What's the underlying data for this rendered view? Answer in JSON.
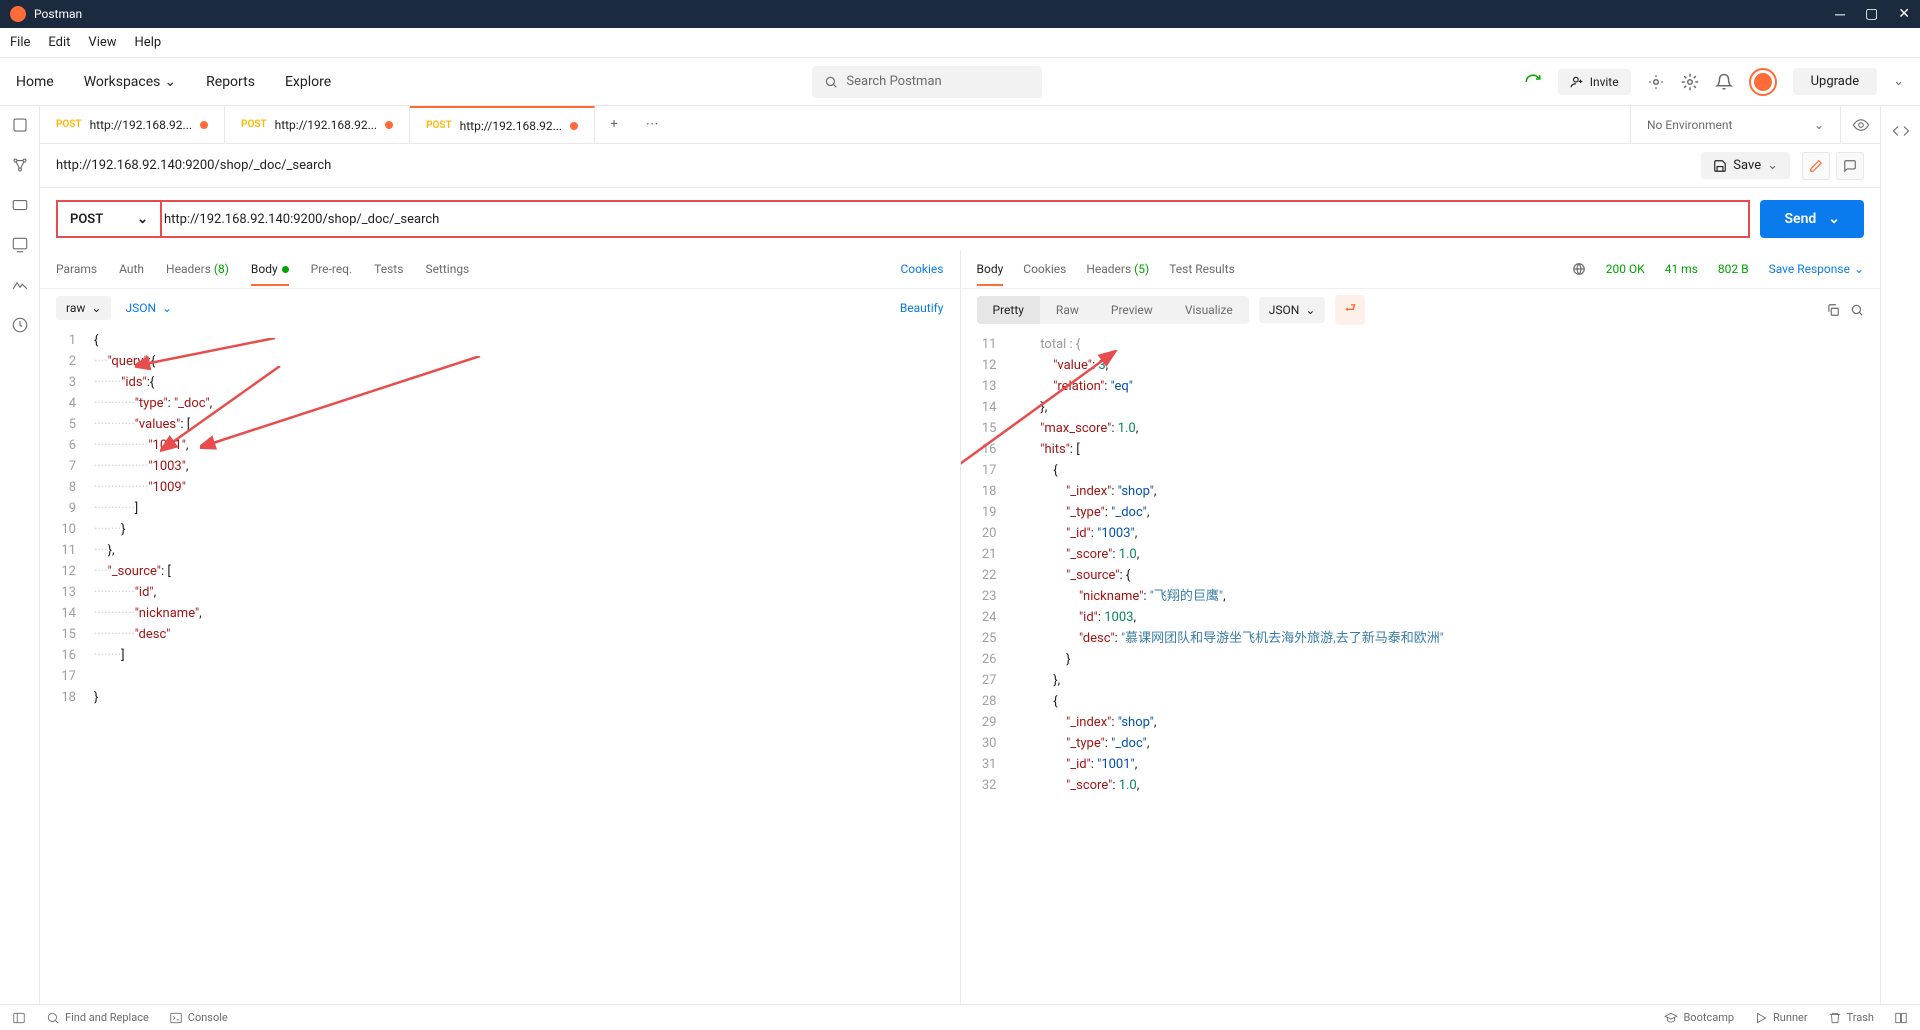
{
  "window": {
    "title": "Postman"
  },
  "menubar": [
    "File",
    "Edit",
    "View",
    "Help"
  ],
  "topnav": {
    "home": "Home",
    "workspaces": "Workspaces",
    "reports": "Reports",
    "explore": "Explore"
  },
  "search": {
    "placeholder": "Search Postman"
  },
  "invite": "Invite",
  "upgrade": "Upgrade",
  "tabs": [
    {
      "method": "POST",
      "label": "http://192.168.92...",
      "dirty": true
    },
    {
      "method": "POST",
      "label": "http://192.168.92...",
      "dirty": true
    },
    {
      "method": "POST",
      "label": "http://192.168.92...",
      "dirty": true
    }
  ],
  "env": {
    "label": "No Environment"
  },
  "request": {
    "title": "http://192.168.92.140:9200/shop/_doc/_search",
    "method": "POST",
    "url": "http://192.168.92.140:9200/shop/_doc/_search",
    "save": "Save",
    "send": "Send"
  },
  "reqTabs": {
    "params": "Params",
    "auth": "Auth",
    "headers": "Headers",
    "headersCount": "(8)",
    "body": "Body",
    "prereq": "Pre-req.",
    "tests": "Tests",
    "settings": "Settings",
    "cookies": "Cookies"
  },
  "bodyToolbar": {
    "raw": "raw",
    "json": "JSON",
    "beautify": "Beautify"
  },
  "reqBody": [
    {
      "n": 1,
      "t": [
        "{"
      ]
    },
    {
      "n": 2,
      "t": [
        "····",
        "\"query\"",
        ":",
        "{"
      ]
    },
    {
      "n": 3,
      "t": [
        "········",
        "\"ids\"",
        ":",
        "{"
      ]
    },
    {
      "n": 4,
      "t": [
        "············",
        "\"type\"",
        ": ",
        "\"_doc\"",
        ","
      ]
    },
    {
      "n": 5,
      "t": [
        "············",
        "\"values\"",
        ": ",
        "["
      ]
    },
    {
      "n": 6,
      "t": [
        "················",
        "\"1001\"",
        ","
      ]
    },
    {
      "n": 7,
      "t": [
        "················",
        "\"1003\"",
        ","
      ]
    },
    {
      "n": 8,
      "t": [
        "················",
        "\"1009\""
      ]
    },
    {
      "n": 9,
      "t": [
        "············",
        "]"
      ]
    },
    {
      "n": 10,
      "t": [
        "········",
        "}"
      ]
    },
    {
      "n": 11,
      "t": [
        "····",
        "}",
        ","
      ]
    },
    {
      "n": 12,
      "t": [
        "····",
        "\"_source\"",
        ": ",
        "["
      ]
    },
    {
      "n": 13,
      "t": [
        "············",
        "\"id\"",
        ","
      ]
    },
    {
      "n": 14,
      "t": [
        "············",
        "\"nickname\"",
        ","
      ]
    },
    {
      "n": 15,
      "t": [
        "············",
        "\"desc\""
      ]
    },
    {
      "n": 16,
      "t": [
        "········",
        "]"
      ]
    },
    {
      "n": 17,
      "t": [
        ""
      ]
    },
    {
      "n": 18,
      "t": [
        "}"
      ]
    }
  ],
  "respTabs": {
    "body": "Body",
    "cookies": "Cookies",
    "headers": "Headers",
    "headersCount": "(5)",
    "testResults": "Test Results"
  },
  "respMeta": {
    "status": "200 OK",
    "time": "41 ms",
    "size": "802 B",
    "save": "Save Response"
  },
  "respToolbar": {
    "pretty": "Pretty",
    "raw": "Raw",
    "preview": "Preview",
    "visualize": "Visualize",
    "json": "JSON"
  },
  "respBody": [
    {
      "n": 11,
      "segs": [
        {
          "c": "jcomment",
          "t": "        total : {"
        }
      ]
    },
    {
      "n": 12,
      "segs": [
        {
          "c": "jp",
          "t": "            "
        },
        {
          "c": "jk",
          "t": "\"value\""
        },
        {
          "c": "jp",
          "t": ": "
        },
        {
          "c": "jn",
          "t": "3"
        },
        {
          "c": "jp",
          "t": ","
        }
      ]
    },
    {
      "n": 13,
      "segs": [
        {
          "c": "jp",
          "t": "            "
        },
        {
          "c": "jk",
          "t": "\"relation\""
        },
        {
          "c": "jp",
          "t": ": "
        },
        {
          "c": "js",
          "t": "\"eq\""
        }
      ]
    },
    {
      "n": 14,
      "segs": [
        {
          "c": "jp",
          "t": "        },"
        }
      ]
    },
    {
      "n": 15,
      "segs": [
        {
          "c": "jp",
          "t": "        "
        },
        {
          "c": "jk",
          "t": "\"max_score\""
        },
        {
          "c": "jp",
          "t": ": "
        },
        {
          "c": "jn",
          "t": "1.0"
        },
        {
          "c": "jp",
          "t": ","
        }
      ]
    },
    {
      "n": 16,
      "segs": [
        {
          "c": "jp",
          "t": "        "
        },
        {
          "c": "jk",
          "t": "\"hits\""
        },
        {
          "c": "jp",
          "t": ": ["
        }
      ]
    },
    {
      "n": 17,
      "segs": [
        {
          "c": "jp",
          "t": "            {"
        }
      ]
    },
    {
      "n": 18,
      "segs": [
        {
          "c": "jp",
          "t": "                "
        },
        {
          "c": "jk",
          "t": "\"_index\""
        },
        {
          "c": "jp",
          "t": ": "
        },
        {
          "c": "js",
          "t": "\"shop\""
        },
        {
          "c": "jp",
          "t": ","
        }
      ]
    },
    {
      "n": 19,
      "segs": [
        {
          "c": "jp",
          "t": "                "
        },
        {
          "c": "jk",
          "t": "\"_type\""
        },
        {
          "c": "jp",
          "t": ": "
        },
        {
          "c": "js",
          "t": "\"_doc\""
        },
        {
          "c": "jp",
          "t": ","
        }
      ]
    },
    {
      "n": 20,
      "segs": [
        {
          "c": "jp",
          "t": "                "
        },
        {
          "c": "jk",
          "t": "\"_id\""
        },
        {
          "c": "jp",
          "t": ": "
        },
        {
          "c": "js",
          "t": "\"1003\""
        },
        {
          "c": "jp",
          "t": ","
        }
      ]
    },
    {
      "n": 21,
      "segs": [
        {
          "c": "jp",
          "t": "                "
        },
        {
          "c": "jk",
          "t": "\"_score\""
        },
        {
          "c": "jp",
          "t": ": "
        },
        {
          "c": "jn",
          "t": "1.0"
        },
        {
          "c": "jp",
          "t": ","
        }
      ]
    },
    {
      "n": 22,
      "segs": [
        {
          "c": "jp",
          "t": "                "
        },
        {
          "c": "jk",
          "t": "\"_source\""
        },
        {
          "c": "jp",
          "t": ": {"
        }
      ]
    },
    {
      "n": 23,
      "segs": [
        {
          "c": "jp",
          "t": "                    "
        },
        {
          "c": "jk",
          "t": "\"nickname\""
        },
        {
          "c": "jp",
          "t": ": "
        },
        {
          "c": "jdesc",
          "t": "\"飞翔的巨鹰\""
        },
        {
          "c": "jp",
          "t": ","
        }
      ]
    },
    {
      "n": 24,
      "segs": [
        {
          "c": "jp",
          "t": "                    "
        },
        {
          "c": "jk",
          "t": "\"id\""
        },
        {
          "c": "jp",
          "t": ": "
        },
        {
          "c": "jn",
          "t": "1003"
        },
        {
          "c": "jp",
          "t": ","
        }
      ]
    },
    {
      "n": 25,
      "segs": [
        {
          "c": "jp",
          "t": "                    "
        },
        {
          "c": "jk",
          "t": "\"desc\""
        },
        {
          "c": "jp",
          "t": ": "
        },
        {
          "c": "jdesc",
          "t": "\"慕课网团队和导游坐飞机去海外旅游,去了新马泰和欧洲\""
        }
      ]
    },
    {
      "n": 26,
      "segs": [
        {
          "c": "jp",
          "t": "                }"
        }
      ]
    },
    {
      "n": 27,
      "segs": [
        {
          "c": "jp",
          "t": "            },"
        }
      ]
    },
    {
      "n": 28,
      "segs": [
        {
          "c": "jp",
          "t": "            {"
        }
      ]
    },
    {
      "n": 29,
      "segs": [
        {
          "c": "jp",
          "t": "                "
        },
        {
          "c": "jk",
          "t": "\"_index\""
        },
        {
          "c": "jp",
          "t": ": "
        },
        {
          "c": "js",
          "t": "\"shop\""
        },
        {
          "c": "jp",
          "t": ","
        }
      ]
    },
    {
      "n": 30,
      "segs": [
        {
          "c": "jp",
          "t": "                "
        },
        {
          "c": "jk",
          "t": "\"_type\""
        },
        {
          "c": "jp",
          "t": ": "
        },
        {
          "c": "js",
          "t": "\"_doc\""
        },
        {
          "c": "jp",
          "t": ","
        }
      ]
    },
    {
      "n": 31,
      "segs": [
        {
          "c": "jp",
          "t": "                "
        },
        {
          "c": "jk",
          "t": "\"_id\""
        },
        {
          "c": "jp",
          "t": ": "
        },
        {
          "c": "js",
          "t": "\"1001\""
        },
        {
          "c": "jp",
          "t": ","
        }
      ]
    },
    {
      "n": 32,
      "segs": [
        {
          "c": "jp",
          "t": "                "
        },
        {
          "c": "jk",
          "t": "\"_score\""
        },
        {
          "c": "jp",
          "t": ": "
        },
        {
          "c": "jn",
          "t": "1.0"
        },
        {
          "c": "jp",
          "t": ","
        }
      ]
    }
  ],
  "statusbar": {
    "find": "Find and Replace",
    "console": "Console",
    "bootcamp": "Bootcamp",
    "runner": "Runner",
    "trash": "Trash"
  }
}
